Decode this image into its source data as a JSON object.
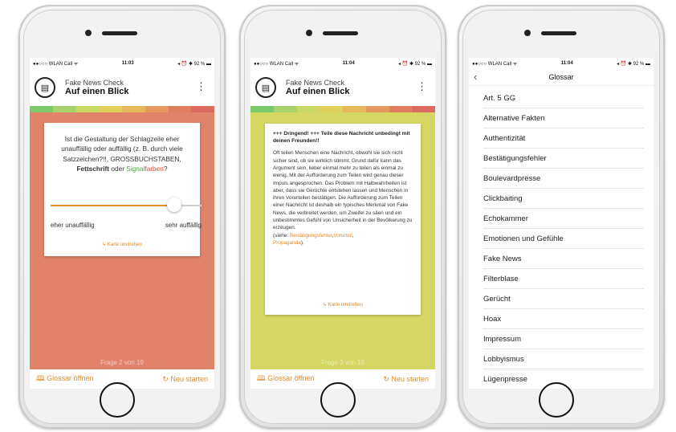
{
  "screen1": {
    "status": {
      "left": "●●○○○ WLAN Call ᯤ",
      "time": "11:03",
      "right": "◂ ⏰ ✱ 92 % ▬"
    },
    "appbar": {
      "subtitle": "Fake News Check",
      "title": "Auf einen Blick",
      "menu": "⋮"
    },
    "card": {
      "question_part1": "Ist die Gestaltung der Schlagzeile eher unauffällig oder auffällig (z. B. durch viele Satzzeichen?!!, GROSSBUCHSTABEN,",
      "bold_word": "Fettschrift",
      "conj": "oder",
      "signal_green": "Signal",
      "signal_red": "farben",
      "qmark": "?",
      "slider_left": "eher unauffällig",
      "slider_right": "sehr auffällig",
      "slider_value": 0.82,
      "flip": "↳ Karte umdrehen"
    },
    "counter": "Frage 2 von 19",
    "bottom": {
      "glossar": "Glossar öffnen",
      "restart": "Neu starten"
    },
    "background_color": "#e0836a"
  },
  "screen2": {
    "status": {
      "left": "●●○○○ WLAN Call ᯤ",
      "time": "11:04",
      "right": "◂ ⏰ ✱ 92 % ▬"
    },
    "appbar": {
      "subtitle": "Fake News Check",
      "title": "Auf einen Blick",
      "menu": "⋮"
    },
    "card": {
      "headline": "+++ Dringend! +++ Teile diese Nachricht unbedingt mit deinen Freunden!!",
      "body": "Oft teilen Menschen eine Nachricht, obwohl sie sich nicht sicher sind, ob sie wirklich stimmt. Grund dafür kann das Argument sein, lieber einmal mehr zu teilen als einmal zu wenig. Mit der Aufforderung zum Teilen wird genau dieser Impuls angesprochen. Das Problem mit Halbwahrheiten ist aber, dass sie Gerüchte entstehen lassen und Menschen in ihren Vorurteilen bestätigen. Die Aufforderung zum Teilen einer Nachricht ist deshalb ein typisches Merkmal von Fake News, die verbreitet werden, um Zweifel zu säen und ein unbestimmtes Gefühl von Unsicherheit in der Bevölkerung zu erzeugen.",
      "see_prefix": "(siehe:",
      "link1": "Bestätigungsfehler",
      "link2": "Vorurteil",
      "link3": "Propaganda",
      "see_suffix": ").",
      "flip": "↳ Karte umdrehen"
    },
    "counter": "Frage 3 von 19",
    "bottom": {
      "glossar": "Glossar öffnen",
      "restart": "Neu starten"
    },
    "background_color": "#d4d862"
  },
  "screen3": {
    "status": {
      "left": "●●○○○ WLAN Call ᯤ",
      "time": "11:04",
      "right": "◂ ⏰ ✱ 92 % ▬"
    },
    "header": {
      "title": "Glossar",
      "back": "‹"
    },
    "items": [
      "Art. 5 GG",
      "Alternative Fakten",
      "Authentizität",
      "Bestätigungsfehler",
      "Boulevardpresse",
      "Clickbaiting",
      "Echokammer",
      "Emotionen und Gefühle",
      "Fake News",
      "Filterblase",
      "Gerücht",
      "Hoax",
      "Impressum",
      "Lobbyismus",
      "Lügenpresse"
    ]
  },
  "colors": {
    "accent": "#e08a2b",
    "stripe": [
      "#7bc96a",
      "#a8d36a",
      "#c8d865",
      "#dfd05c",
      "#e7b85b",
      "#e39a5c",
      "#e07f5f",
      "#dc6a60"
    ],
    "link_green": "#49a83b",
    "link_red": "#e0453a"
  }
}
